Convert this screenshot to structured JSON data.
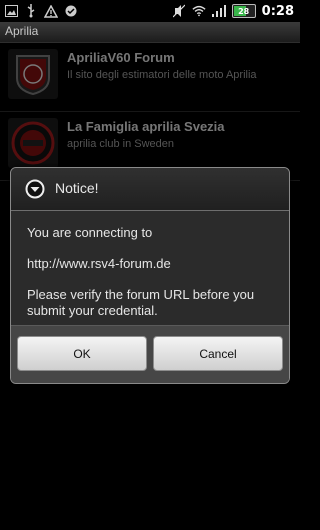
{
  "status_bar": {
    "time": "0:28",
    "battery_label": "28",
    "left_icons": [
      "image-icon",
      "usb-icon",
      "warning-icon",
      "check-badge-icon"
    ],
    "right_icons": [
      "mute-icon",
      "wifi-icon",
      "signal-icon",
      "battery-icon"
    ]
  },
  "app": {
    "title": "Aprilia"
  },
  "list": {
    "items": [
      {
        "name": "ApriliaV60 Forum",
        "desc": "Il sito degli estimatori delle moto Aprilia"
      },
      {
        "name": "La Famiglia aprilia Svezia",
        "desc": "aprilia club in Sweden"
      }
    ]
  },
  "dialog": {
    "title": "Notice!",
    "line1": "You are connecting to",
    "url": "http://www.rsv4-forum.de",
    "line3a": "Please verify the forum URL before you",
    "line3b": "submit your credential.",
    "ok_label": "OK",
    "cancel_label": "Cancel"
  },
  "colors": {
    "background": "#000000",
    "dialog_bg": "#2b2b2b",
    "dialog_footer": "#464646",
    "battery_green": "#39b54a"
  }
}
